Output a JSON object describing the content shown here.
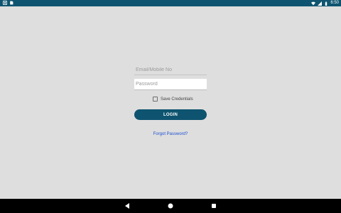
{
  "status_bar": {
    "time": "6:50",
    "icons": [
      "notification-icon",
      "sim-icon",
      "wifi-icon",
      "signal-icon",
      "battery-icon"
    ]
  },
  "login_form": {
    "email_placeholder": "Email/Mobile No",
    "email_value": "",
    "password_placeholder": "Password",
    "password_value": "",
    "save_credentials_label": "Save Credentials",
    "save_credentials_checked": false,
    "login_label": "LOGIN",
    "forgot_password_label": "Forgot Password?"
  },
  "nav_bar": {
    "buttons": [
      "back-icon",
      "home-icon",
      "recents-icon"
    ]
  },
  "colors": {
    "primary": "#0e5470",
    "background": "#dedede",
    "link": "#1f4fd1"
  }
}
